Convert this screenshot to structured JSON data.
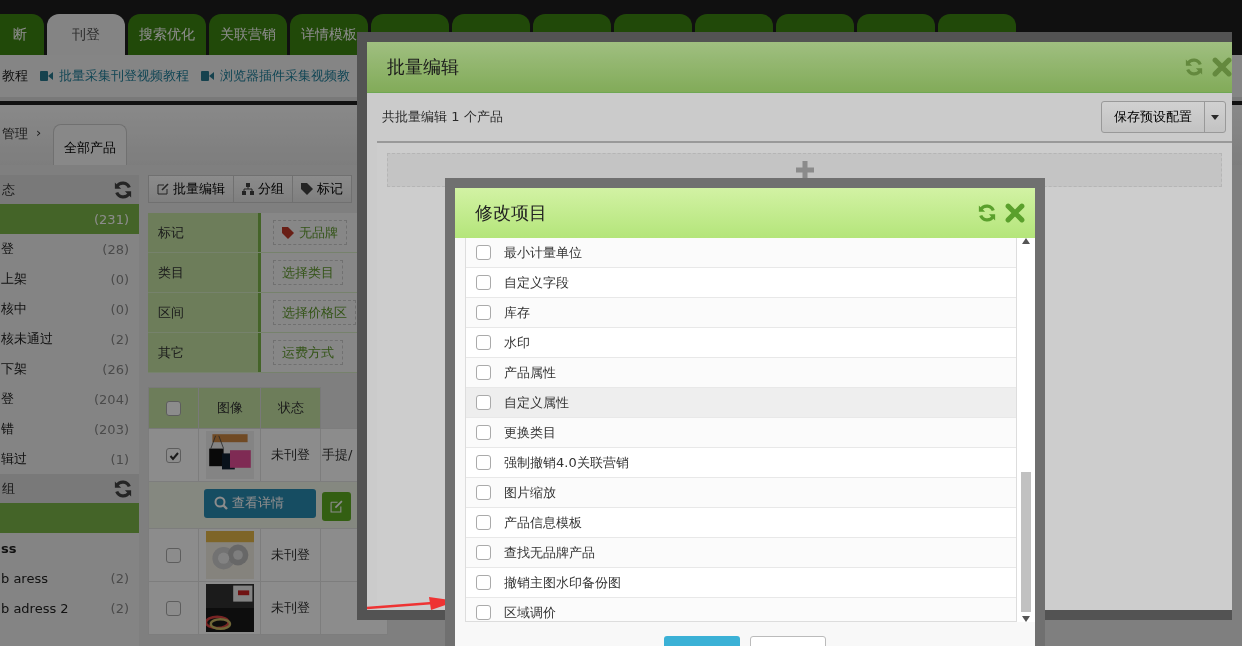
{
  "top_tabs": [
    {
      "label": "断",
      "selected": false
    },
    {
      "label": "刊登",
      "selected": true
    },
    {
      "label": "搜索优化",
      "selected": false
    },
    {
      "label": "关联营销",
      "selected": false
    },
    {
      "label": "详情模板",
      "selected": false
    }
  ],
  "tutorial_links": [
    {
      "label": "教程",
      "kind": "text"
    },
    {
      "label": "批量采集刊登视频教程",
      "kind": "video"
    },
    {
      "label": "浏览器插件采集视频教",
      "kind": "video"
    }
  ],
  "breadcrumb": {
    "parent": "管理",
    "separator": "›",
    "current": "全部产品"
  },
  "sidebar": [
    {
      "title": "态",
      "items": [
        {
          "count": "(231)",
          "selected": true
        },
        {
          "label": "登",
          "count": "(28)",
          "selected": false
        },
        {
          "label": "上架",
          "count": "(0)",
          "selected": false
        },
        {
          "label": "核中",
          "count": "(0)",
          "selected": false
        },
        {
          "label": "核未通过",
          "count": "(2)",
          "selected": false
        },
        {
          "label": "下架",
          "count": "(26)",
          "selected": false
        },
        {
          "label": "登",
          "count": "(204)",
          "selected": false
        },
        {
          "label": "错",
          "count": "(203)",
          "selected": false
        },
        {
          "label": "辑过",
          "count": "(1)",
          "selected": false
        }
      ]
    },
    {
      "title": "组",
      "items": [
        {
          "selected": true
        },
        {
          "label": "ss",
          "kind": "heading",
          "selected": false
        },
        {
          "label": "b aress",
          "count": "(2)",
          "selected": false
        },
        {
          "label": "b adress 2",
          "count": "(2)",
          "selected": false
        }
      ]
    }
  ],
  "toolbar": [
    "批量编辑",
    "分组",
    "标记"
  ],
  "filters": [
    {
      "label": "标记",
      "option": "无品牌",
      "kind": "tag"
    },
    {
      "label": "类目",
      "option": "选择类目",
      "kind": "plain"
    },
    {
      "label": "区间",
      "option": "选择价格区",
      "kind": "plain"
    },
    {
      "label": "其它",
      "option": "运费方式",
      "kind": "plain"
    }
  ],
  "table": {
    "header_checked": false,
    "columns": [
      "图像",
      "状态"
    ],
    "rows": [
      {
        "checked": true,
        "status": "未刊登",
        "category": [
          "手提/"
        ],
        "actions": {
          "details": "查看详情"
        }
      },
      {
        "checked": false,
        "status": "未刊登"
      },
      {
        "checked": false,
        "status": "未刊登"
      }
    ]
  },
  "batch_dialog": {
    "title": "批量编辑",
    "summary": "共批量编辑 1 个产品",
    "save_button": "保存预设配置"
  },
  "items_dialog": {
    "title": "修改项目",
    "items": [
      {
        "label": "最小计量单位",
        "checked": false,
        "hovered": false
      },
      {
        "label": "自定义字段",
        "checked": false,
        "hovered": false
      },
      {
        "label": "库存",
        "checked": false,
        "hovered": false
      },
      {
        "label": "水印",
        "checked": false,
        "hovered": false
      },
      {
        "label": "产品属性",
        "checked": false,
        "hovered": false
      },
      {
        "label": "自定义属性",
        "checked": false,
        "hovered": true
      },
      {
        "label": "更换类目",
        "checked": false,
        "hovered": false
      },
      {
        "label": "强制撤销4.0关联营销",
        "checked": false,
        "hovered": false
      },
      {
        "label": "图片缩放",
        "checked": false,
        "hovered": false
      },
      {
        "label": "产品信息模板",
        "checked": false,
        "hovered": false
      },
      {
        "label": "查找无品牌产品",
        "checked": false,
        "hovered": false
      },
      {
        "label": "撤销主图水印备份图",
        "checked": false,
        "hovered": false
      },
      {
        "label": "区域调价",
        "checked": false,
        "hovered": false
      }
    ]
  }
}
